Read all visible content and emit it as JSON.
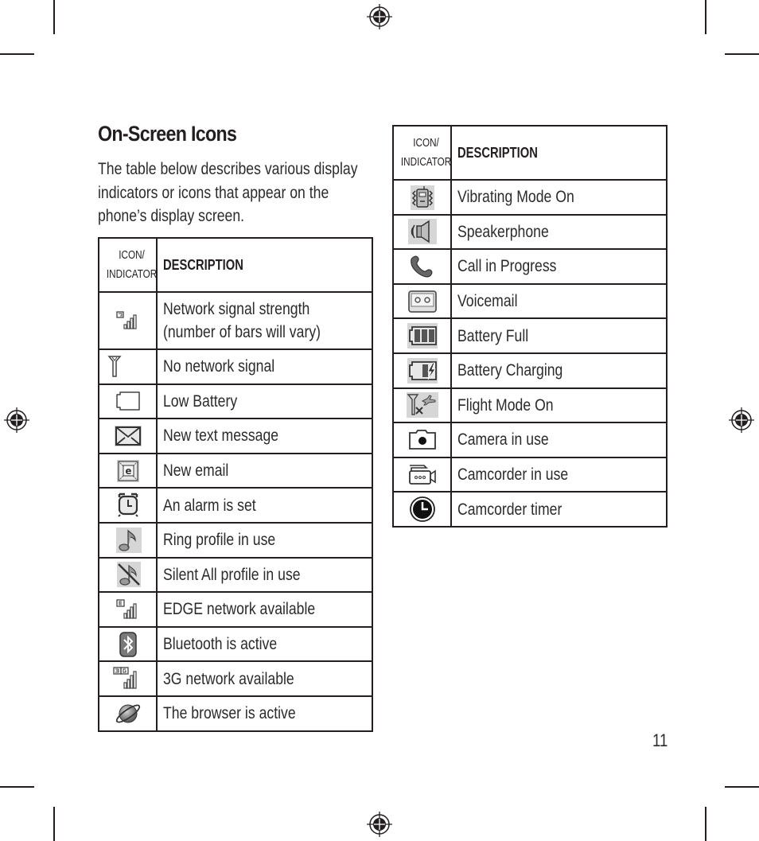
{
  "page": {
    "title": "On-Screen Icons",
    "intro": "The table below describes various display indicators or icons that appear on the phone’s display screen.",
    "page_number": "11"
  },
  "table_headers": {
    "icon_line1": "ICON/",
    "icon_line2": "INDICATOR",
    "description": "DESCRIPTION"
  },
  "left_table": {
    "rows": [
      {
        "icon": "network-signal-g-icon",
        "description": "Network signal strength (number of bars will vary)"
      },
      {
        "icon": "no-network-antenna-icon",
        "description": "No network signal"
      },
      {
        "icon": "low-battery-icon",
        "description": "Low Battery"
      },
      {
        "icon": "envelope-icon",
        "description": "New text message"
      },
      {
        "icon": "email-icon",
        "description": "New email"
      },
      {
        "icon": "alarm-clock-icon",
        "description": "An alarm is set"
      },
      {
        "icon": "music-note-icon",
        "description": "Ring profile in use"
      },
      {
        "icon": "silent-note-icon",
        "description": "Silent All profile in use"
      },
      {
        "icon": "edge-signal-icon",
        "description": "EDGE network available"
      },
      {
        "icon": "bluetooth-icon",
        "description": "Bluetooth is active"
      },
      {
        "icon": "3g-signal-icon",
        "description": "3G network available"
      },
      {
        "icon": "browser-globe-icon",
        "description": "The browser is active"
      }
    ]
  },
  "right_table": {
    "rows": [
      {
        "icon": "vibrate-icon",
        "description": "Vibrating Mode On"
      },
      {
        "icon": "speakerphone-icon",
        "description": "Speakerphone"
      },
      {
        "icon": "phone-handset-icon",
        "description": "Call in Progress"
      },
      {
        "icon": "voicemail-icon",
        "description": "Voicemail"
      },
      {
        "icon": "battery-full-icon",
        "description": "Battery Full"
      },
      {
        "icon": "battery-charging-icon",
        "description": "Battery Charging"
      },
      {
        "icon": "flight-mode-icon",
        "description": "Flight Mode On"
      },
      {
        "icon": "camera-icon",
        "description": "Camera in use"
      },
      {
        "icon": "camcorder-icon",
        "description": "Camcorder in use"
      },
      {
        "icon": "timer-icon",
        "description": "Camcorder timer"
      }
    ]
  }
}
